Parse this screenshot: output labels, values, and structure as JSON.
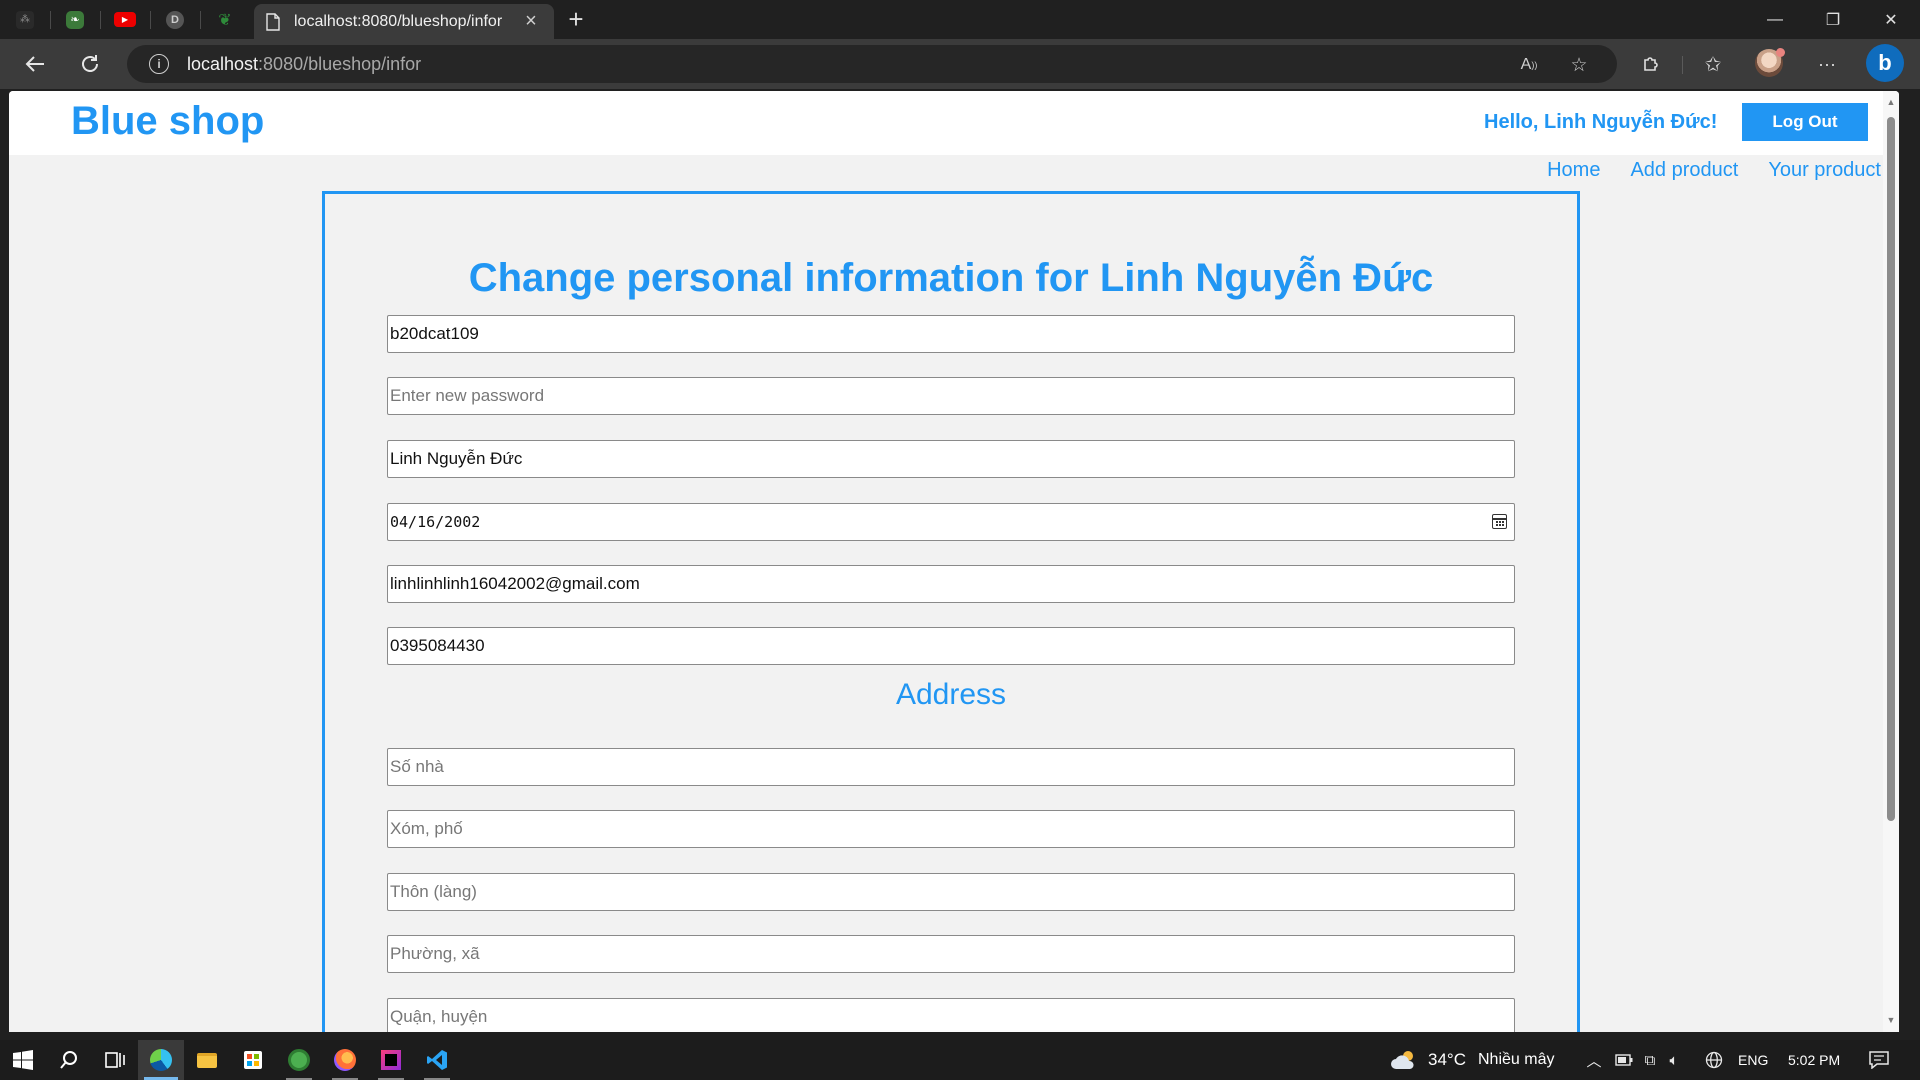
{
  "browser": {
    "tab_title": "localhost:8080/blueshop/infor",
    "url_host": "localhost",
    "url_rest": ":8080/blueshop/infor",
    "read_aloud_label": "A",
    "new_tab_glyph": "+"
  },
  "site": {
    "brand": "Blue shop",
    "greeting": "Hello, Linh Nguyễn Đức!",
    "logout_label": "Log Out",
    "nav": [
      "Home",
      "Add product",
      "Your product"
    ]
  },
  "form": {
    "title": "Change personal information for Linh Nguyễn Đức",
    "username": "b20dcat109",
    "password_placeholder": "Enter new password",
    "fullname": "Linh Nguyễn Đức",
    "birthdate": "04/16/2002",
    "email": "linhlinhlinh16042002@gmail.com",
    "phone": "0395084430",
    "address_heading": "Address",
    "address_placeholders": [
      "Số nhà",
      "Xóm, phố",
      "Thôn (làng)",
      "Phường, xã",
      "Quận, huyện"
    ]
  },
  "taskbar": {
    "temperature": "34°C",
    "weather": "Nhiều mây",
    "language": "ENG",
    "time": "5:02 PM"
  },
  "colors": {
    "accent": "#2196f3",
    "page_bg": "#f2f2f2",
    "chrome_bg": "#202020"
  }
}
